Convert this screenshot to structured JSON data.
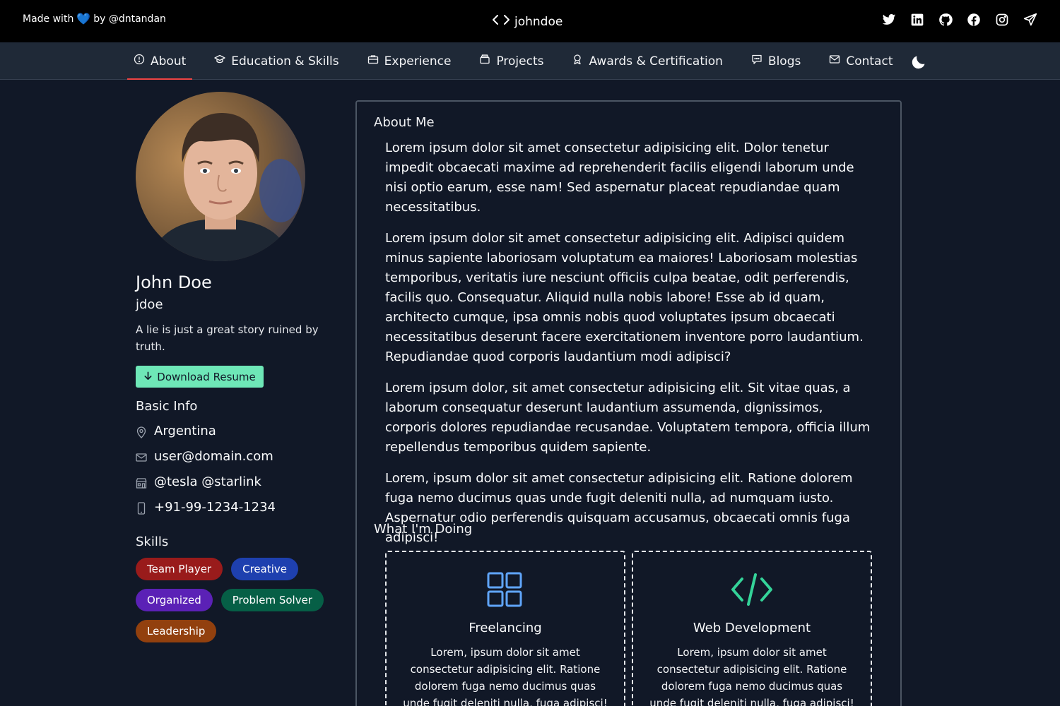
{
  "topbar": {
    "credit_prefix": "Made with",
    "credit_heart": "💙",
    "credit_suffix": "by @dntandan",
    "brand": "johndoe",
    "socials": [
      {
        "name": "twitter-icon"
      },
      {
        "name": "linkedin-icon"
      },
      {
        "name": "github-icon"
      },
      {
        "name": "facebook-icon"
      },
      {
        "name": "instagram-icon"
      },
      {
        "name": "telegram-icon"
      }
    ]
  },
  "nav": {
    "items": [
      {
        "label": "About",
        "icon": "info-icon",
        "active": true
      },
      {
        "label": "Education & Skills",
        "icon": "graduation-cap-icon"
      },
      {
        "label": "Experience",
        "icon": "briefcase-icon"
      },
      {
        "label": "Projects",
        "icon": "archive-icon"
      },
      {
        "label": "Awards & Certification",
        "icon": "award-icon"
      },
      {
        "label": "Blogs",
        "icon": "chat-icon"
      },
      {
        "label": "Contact",
        "icon": "mail-icon"
      }
    ],
    "theme_icon": "moon-icon"
  },
  "profile": {
    "name": "John Doe",
    "handle": "jdoe",
    "tagline": "A lie is just a great story ruined by truth.",
    "resume_label": "Download Resume",
    "basic_info_title": "Basic Info",
    "info": [
      {
        "icon": "location-pin-icon",
        "text": "Argentina"
      },
      {
        "icon": "envelope-icon",
        "text": "user@domain.com"
      },
      {
        "icon": "building-icon",
        "text": "@tesla @starlink"
      },
      {
        "icon": "phone-icon",
        "text": "+91-99-1234-1234"
      }
    ],
    "skills_title": "Skills",
    "skills": [
      {
        "label": "Team Player",
        "color": "#991b1b"
      },
      {
        "label": "Creative",
        "color": "#1e40af"
      },
      {
        "label": "Organized",
        "color": "#5b21b6"
      },
      {
        "label": "Problem Solver",
        "color": "#065f46"
      },
      {
        "label": "Leadership",
        "color": "#92400e"
      }
    ]
  },
  "about": {
    "title": "About Me",
    "paragraphs": [
      "Lorem ipsum dolor sit amet consectetur adipisicing elit. Dolor tenetur impedit obcaecati maxime ad reprehenderit facilis eligendi laborum unde nisi optio earum, esse nam! Sed aspernatur placeat repudiandae quam necessitatibus.",
      "Lorem ipsum dolor sit amet consectetur adipisicing elit. Adipisci quidem minus sapiente laboriosam voluptatum ea maiores! Laboriosam molestias temporibus, veritatis iure nesciunt officiis culpa beatae, odit perferendis, facilis quo. Consequatur. Aliquid nulla nobis labore! Esse ab id quam, architecto cumque, ipsa omnis nobis quod voluptates ipsum obcaecati necessitatibus deserunt facere exercitationem inventore porro laudantium. Repudiandae quod corporis laudantium modi adipisci?",
      "Lorem ipsum dolor, sit amet consectetur adipisicing elit. Sit vitae quas, a laborum consequatur deserunt laudantium assumenda, dignissimos, corporis dolores repudiandae recusandae. Voluptatem tempora, officia illum repellendus temporibus quidem sapiente.",
      "Lorem, ipsum dolor sit amet consectetur adipisicing elit. Ratione dolorem fuga nemo ducimus quas unde fugit deleniti nulla, ad numquam iusto. Aspernatur odio perferendis quisquam accusamus, obcaecati omnis fuga adipisci!"
    ],
    "doing_title": "What I'm Doing",
    "services": [
      {
        "title": "Freelancing",
        "icon": "grid-icon",
        "icon_color": "#60a5fa",
        "desc": "Lorem, ipsum dolor sit amet consectetur adipisicing elit. Ratione dolorem fuga nemo ducimus quas unde fugit deleniti nulla, fuga adipisci!"
      },
      {
        "title": "Web Development",
        "icon": "code-icon",
        "icon_color": "#34d399",
        "desc": "Lorem, ipsum dolor sit amet consectetur adipisicing elit. Ratione dolorem fuga nemo ducimus quas unde fugit deleniti nulla, fuga adipisci!"
      }
    ]
  }
}
